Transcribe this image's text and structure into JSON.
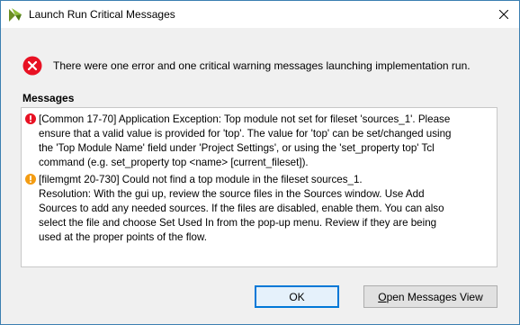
{
  "window": {
    "title": "Launch Run Critical Messages"
  },
  "header": {
    "icon": "error-icon",
    "text": "There were one error and one critical warning messages launching implementation run."
  },
  "messages_section": {
    "label": "Messages",
    "items": [
      {
        "severity": "error",
        "icon": "error-icon",
        "text": "[Common 17-70] Application Exception: Top module not set for fileset 'sources_1'. Please\nensure that a valid value is provided for 'top'. The value for 'top' can be set/changed using\nthe 'Top Module Name' field under 'Project Settings', or using the 'set_property top' Tcl\ncommand (e.g. set_property top <name> [current_fileset])."
      },
      {
        "severity": "critical-warning",
        "icon": "warning-icon",
        "text": "[filemgmt 20-730] Could not find a top module in the fileset sources_1.\nResolution: With the gui up, review the source files in the Sources window. Use Add\nSources to add any needed sources. If the files are disabled, enable them. You can also\nselect the file and choose Set Used In from the pop-up menu. Review if they are being\nused at the proper points of the flow."
      }
    ]
  },
  "buttons": {
    "ok_label": "OK",
    "open_messages_first": "O",
    "open_messages_rest": "pen Messages View"
  },
  "colors": {
    "error": "#e81123",
    "warning": "#f39c12",
    "focus_border": "#0078d7"
  }
}
